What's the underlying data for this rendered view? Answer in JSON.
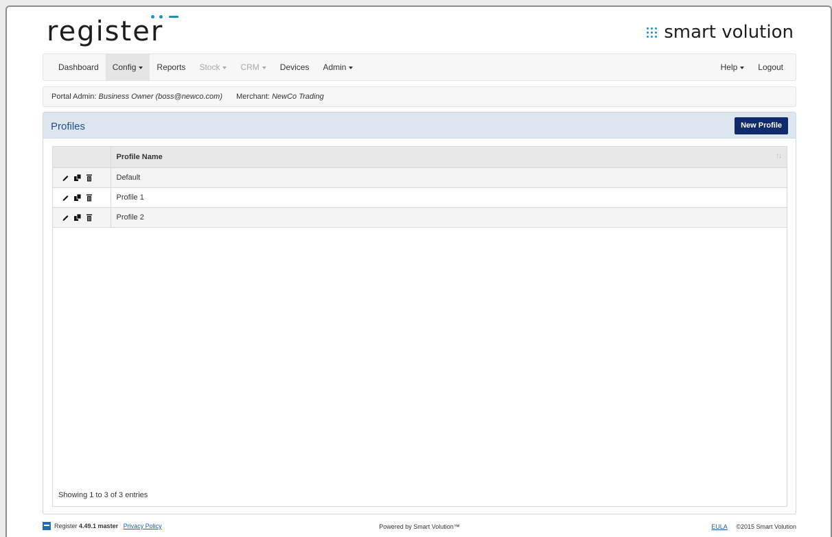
{
  "brand": {
    "left_logo": "register",
    "right_logo": "smart volution",
    "accent": "#1a8fc9"
  },
  "nav": {
    "left": [
      {
        "label": "Dashboard",
        "dropdown": false,
        "active": false,
        "disabled": false
      },
      {
        "label": "Config",
        "dropdown": true,
        "active": true,
        "disabled": false
      },
      {
        "label": "Reports",
        "dropdown": false,
        "active": false,
        "disabled": false
      },
      {
        "label": "Stock",
        "dropdown": true,
        "active": false,
        "disabled": true
      },
      {
        "label": "CRM",
        "dropdown": true,
        "active": false,
        "disabled": true
      },
      {
        "label": "Devices",
        "dropdown": false,
        "active": false,
        "disabled": false
      },
      {
        "label": "Admin",
        "dropdown": true,
        "active": false,
        "disabled": false
      }
    ],
    "right": [
      {
        "label": "Help",
        "dropdown": true
      },
      {
        "label": "Logout",
        "dropdown": false
      }
    ]
  },
  "info": {
    "portal_admin_label": "Portal Admin:",
    "portal_admin_value": "Business Owner (boss@newco.com)",
    "merchant_label": "Merchant:",
    "merchant_value": "NewCo Trading"
  },
  "panel": {
    "title": "Profiles",
    "new_button": "New Profile",
    "header_color": "#dde6ef",
    "button_color": "#0f2b6b"
  },
  "table": {
    "columns": [
      "",
      "Profile Name"
    ],
    "row_actions": [
      "pencil-icon",
      "copy-icon",
      "trash-icon"
    ],
    "rows": [
      {
        "name": "Default"
      },
      {
        "name": "Profile 1"
      },
      {
        "name": "Profile 2"
      }
    ],
    "info": "Showing 1 to 3 of 3 entries"
  },
  "footer": {
    "version_label": "Register",
    "version_value": "4.49.1 master",
    "privacy": "Privacy Policy",
    "powered": "Powered by Smart Volution™",
    "eula": "EULA",
    "copyright": "©2015 Smart Volution"
  }
}
